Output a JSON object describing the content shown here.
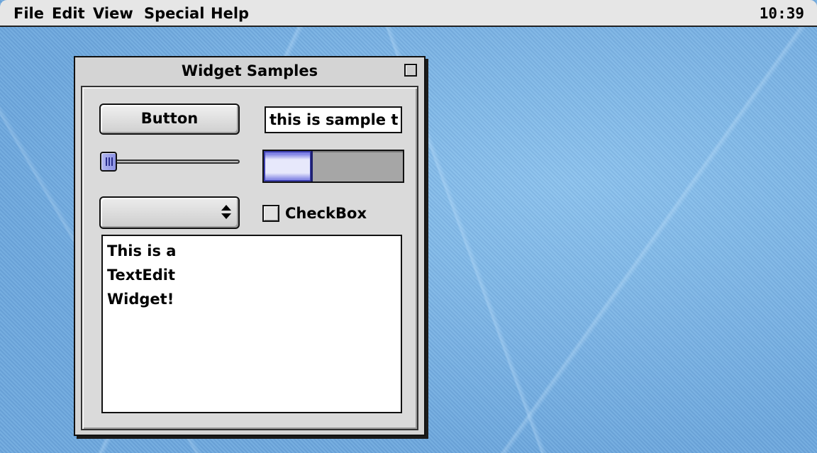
{
  "menubar": {
    "items": [
      "File",
      "Edit",
      "View",
      "Special",
      "Help"
    ],
    "clock": "10:39"
  },
  "window": {
    "title": "Widget Samples",
    "button_label": "Button",
    "text_field_value": "this is sample t",
    "slider_value": 0,
    "progress_fraction": 0.35,
    "popup_value": "",
    "checkbox_label": "CheckBox",
    "checkbox_checked": false,
    "text_edit_lines": [
      "This is a",
      "TextEdit",
      "Widget!"
    ]
  },
  "colors": {
    "desktop": "#7ab4e6",
    "window_bg": "#d4d4d4",
    "accent": "#8c92e4"
  }
}
